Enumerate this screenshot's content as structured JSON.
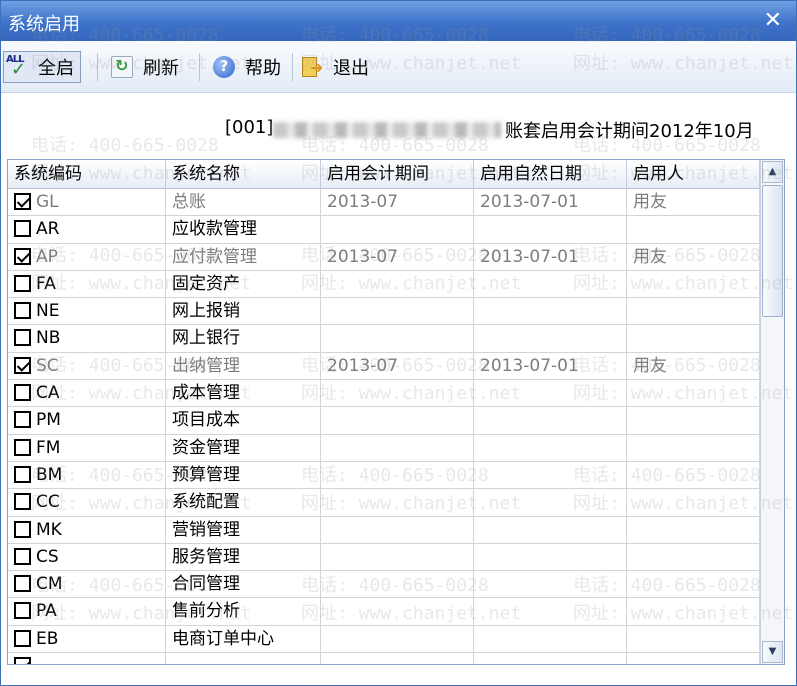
{
  "window": {
    "title": "系统启用",
    "close_glyph": "✕"
  },
  "toolbar": {
    "select_all": {
      "label": "全启",
      "icon": "select-all-icon",
      "icon_text": "ALL",
      "check": "✓"
    },
    "refresh": {
      "label": "刷新",
      "icon": "refresh-icon",
      "glyph": "↻"
    },
    "help": {
      "label": "帮助",
      "icon": "help-icon",
      "glyph": "?"
    },
    "exit": {
      "label": "退出",
      "icon": "exit-icon",
      "glyph": "➜"
    }
  },
  "account_info": {
    "code": "[001]",
    "suffix": "账套启用会计期间2012年10月"
  },
  "grid": {
    "columns": [
      "系统编码",
      "系统名称",
      "启用会计期间",
      "启用自然日期",
      "启用人"
    ],
    "rows": [
      {
        "code": "GL",
        "name": "总账",
        "period": "2013-07",
        "date": "2013-07-01",
        "user": "用友",
        "checked": true
      },
      {
        "code": "AR",
        "name": "应收款管理",
        "period": "",
        "date": "",
        "user": "",
        "checked": false
      },
      {
        "code": "AP",
        "name": "应付款管理",
        "period": "2013-07",
        "date": "2013-07-01",
        "user": "用友",
        "checked": true
      },
      {
        "code": "FA",
        "name": "固定资产",
        "period": "",
        "date": "",
        "user": "",
        "checked": false
      },
      {
        "code": "NE",
        "name": "网上报销",
        "period": "",
        "date": "",
        "user": "",
        "checked": false
      },
      {
        "code": "NB",
        "name": "网上银行",
        "period": "",
        "date": "",
        "user": "",
        "checked": false
      },
      {
        "code": "SC",
        "name": "出纳管理",
        "period": "2013-07",
        "date": "2013-07-01",
        "user": "用友",
        "checked": true
      },
      {
        "code": "CA",
        "name": "成本管理",
        "period": "",
        "date": "",
        "user": "",
        "checked": false
      },
      {
        "code": "PM",
        "name": "项目成本",
        "period": "",
        "date": "",
        "user": "",
        "checked": false
      },
      {
        "code": "FM",
        "name": "资金管理",
        "period": "",
        "date": "",
        "user": "",
        "checked": false
      },
      {
        "code": "BM",
        "name": "预算管理",
        "period": "",
        "date": "",
        "user": "",
        "checked": false
      },
      {
        "code": "CC",
        "name": "系统配置",
        "period": "",
        "date": "",
        "user": "",
        "checked": false
      },
      {
        "code": "MK",
        "name": "营销管理",
        "period": "",
        "date": "",
        "user": "",
        "checked": false
      },
      {
        "code": "CS",
        "name": "服务管理",
        "period": "",
        "date": "",
        "user": "",
        "checked": false
      },
      {
        "code": "CM",
        "name": "合同管理",
        "period": "",
        "date": "",
        "user": "",
        "checked": false
      },
      {
        "code": "PA",
        "name": "售前分析",
        "period": "",
        "date": "",
        "user": "",
        "checked": false
      },
      {
        "code": "EB",
        "name": "电商订单中心",
        "period": "",
        "date": "",
        "user": "",
        "checked": false
      }
    ]
  },
  "scrollbar": {
    "up_glyph": "▲",
    "down_glyph": "▼"
  },
  "watermark": {
    "phone": "电话: 400-665-0028",
    "site": "网址: www.chanjet.net"
  }
}
